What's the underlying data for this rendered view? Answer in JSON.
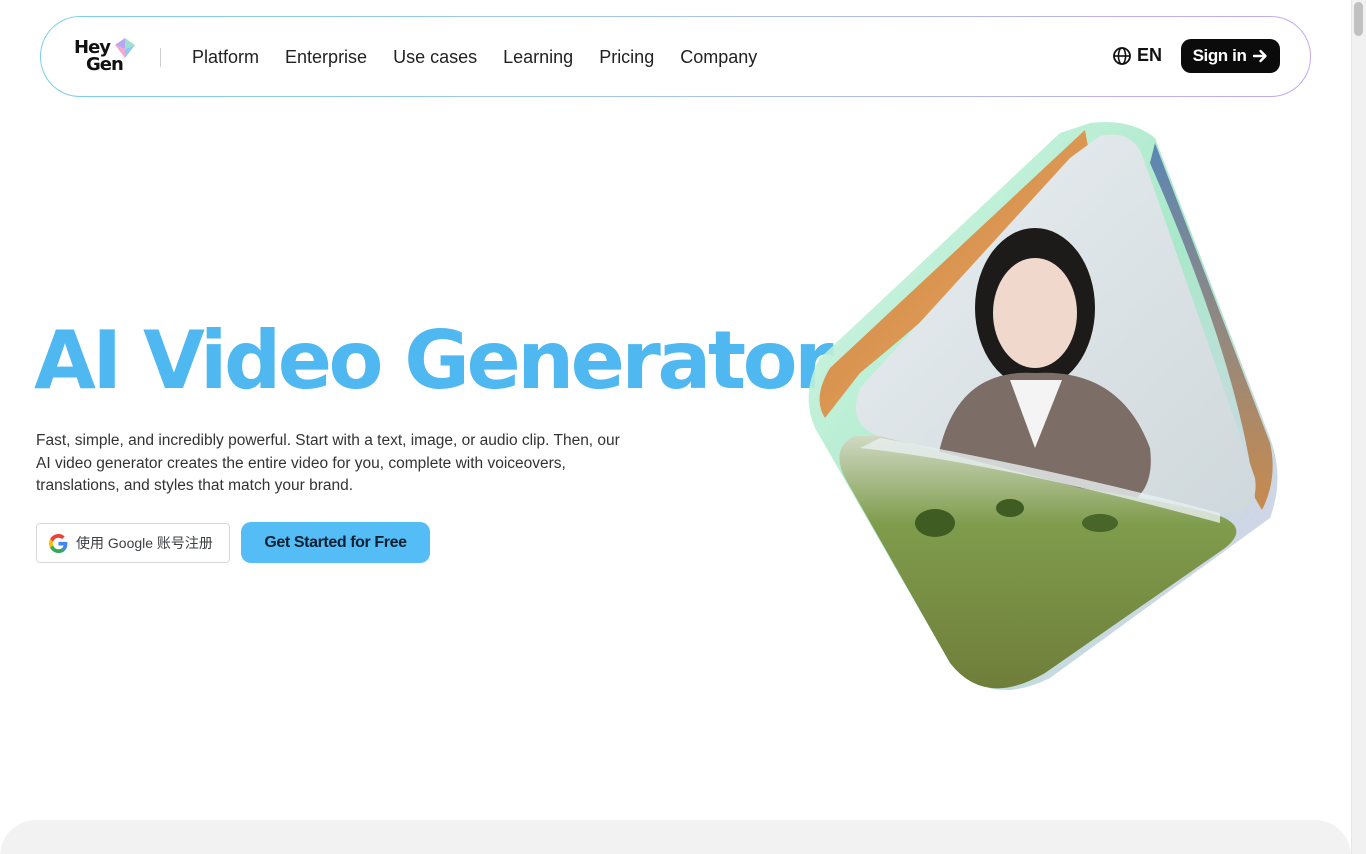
{
  "brand": {
    "logo_line1": "Hey",
    "logo_line2": "Gen"
  },
  "nav": {
    "items": [
      {
        "label": "Platform"
      },
      {
        "label": "Enterprise"
      },
      {
        "label": "Use cases"
      },
      {
        "label": "Learning"
      },
      {
        "label": "Pricing"
      },
      {
        "label": "Company"
      }
    ],
    "language": "EN",
    "signin_label": "Sign in"
  },
  "hero": {
    "title": "AI Video Generator",
    "subtitle": "Fast, simple, and incredibly powerful. Start with a text, image, or audio clip. Then, our AI video generator creates the entire video for you, complete with voiceovers, translations, and styles that match your brand.",
    "google_button_label": "使用 Google 账号注册",
    "cta_label": "Get Started for Free"
  },
  "colors": {
    "accent": "#55bdf5",
    "title": "#4fb8f0",
    "signin_bg": "#0b0b0b"
  },
  "icons": [
    "heygen-gem-icon",
    "globe-icon",
    "arrow-right-icon",
    "google-g-icon"
  ]
}
